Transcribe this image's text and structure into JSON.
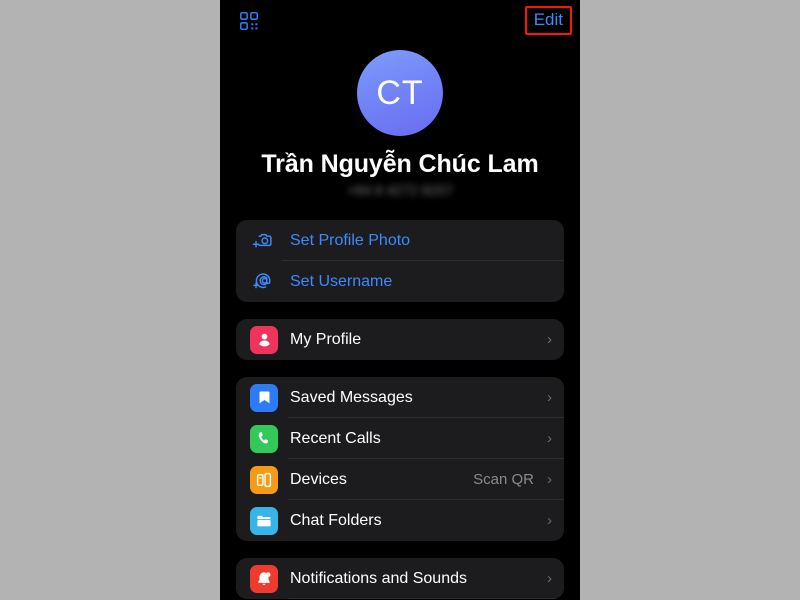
{
  "topbar": {
    "qr_icon": "qr-code-icon",
    "edit_label": "Edit"
  },
  "profile": {
    "avatar_initials": "CT",
    "name": "Trần Nguyễn Chúc Lam",
    "phone": "+84 8 4272 8257"
  },
  "setup_group": [
    {
      "label": "Set Profile Photo",
      "icon": "add-photo-icon"
    },
    {
      "label": "Set Username",
      "icon": "add-username-icon"
    }
  ],
  "profile_group": [
    {
      "label": "My Profile",
      "icon": "person-icon",
      "value": "",
      "chevron": "›"
    }
  ],
  "main_group": [
    {
      "label": "Saved Messages",
      "icon": "bookmark-icon",
      "value": "",
      "chevron": "›"
    },
    {
      "label": "Recent Calls",
      "icon": "phone-icon",
      "value": "",
      "chevron": "›"
    },
    {
      "label": "Devices",
      "icon": "devices-icon",
      "value": "Scan QR",
      "chevron": "›"
    },
    {
      "label": "Chat Folders",
      "icon": "folder-icon",
      "value": "",
      "chevron": "›"
    }
  ],
  "settings_group": [
    {
      "label": "Notifications and Sounds",
      "icon": "bell-icon",
      "value": "",
      "chevron": "›"
    }
  ],
  "colors": {
    "accent_blue": "#3d8bfd",
    "annotation_red": "#ff1500",
    "card_bg": "#1c1c1e",
    "page_bg": "#000000",
    "outer_bg": "#b3b3b3"
  }
}
